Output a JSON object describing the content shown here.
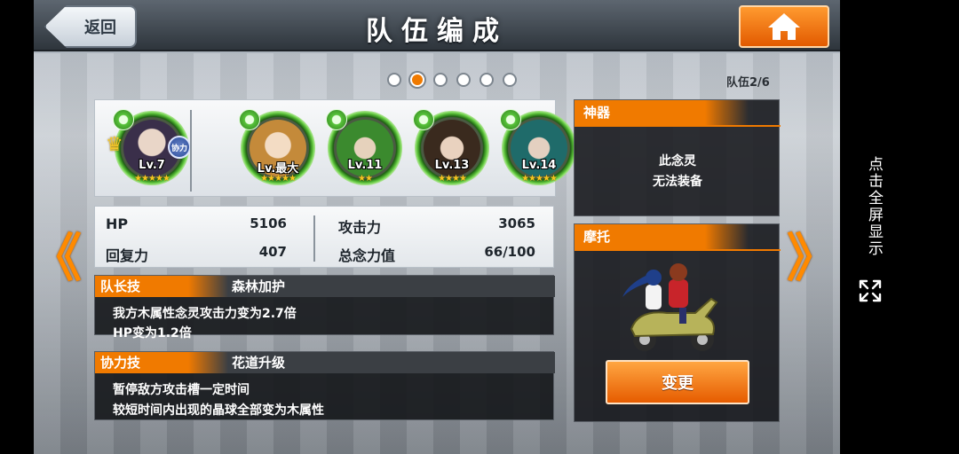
{
  "header": {
    "back_label": "返回",
    "title": "队伍编成",
    "home_icon": "home-icon"
  },
  "pager": {
    "pages": 6,
    "active": 2,
    "team_count": "队伍2/6"
  },
  "members": [
    {
      "level": "Lv.7",
      "stars": "★★★★★",
      "leader": true,
      "assist_badge": "协力",
      "face": "#3a2f4a"
    },
    {
      "level": "Lv.最大",
      "stars": "★★★★★",
      "face": "#c48a3a"
    },
    {
      "level": "Lv.11",
      "stars": "★★",
      "face": "#3b8a2e"
    },
    {
      "level": "Lv.13",
      "stars": "★★★★",
      "face": "#3a2a1e"
    },
    {
      "level": "Lv.14",
      "stars": "★★★★★",
      "face": "#1f6b6a"
    }
  ],
  "stats": {
    "hp_label": "HP",
    "hp_value": "5106",
    "recovery_label": "回复力",
    "recovery_value": "407",
    "attack_label": "攻击力",
    "attack_value": "3065",
    "total_label": "总念力值",
    "total_value": "66/100"
  },
  "leader_skill": {
    "tag": "队长技",
    "name": "森林加护",
    "desc_1": "我方木属性念灵攻击力变为2.7倍",
    "desc_2": "HP变为1.2倍"
  },
  "assist_skill": {
    "tag": "协力技",
    "name": "花道升级",
    "desc_1": "暂停敌方攻击槽一定时间",
    "desc_2": "较短时间内出现的晶球全部变为木属性"
  },
  "artifact": {
    "title": "神器",
    "line_1": "此念灵",
    "line_2": "无法装备"
  },
  "motorbike": {
    "title": "摩托",
    "change_label": "变更"
  },
  "nav": {
    "prev": "《",
    "next": "》"
  },
  "system": {
    "rotate_hint": "点击全屏显示"
  },
  "colors": {
    "accent": "#f07a00",
    "panel_dark": "#141619",
    "nature_green": "#5cc43a"
  }
}
